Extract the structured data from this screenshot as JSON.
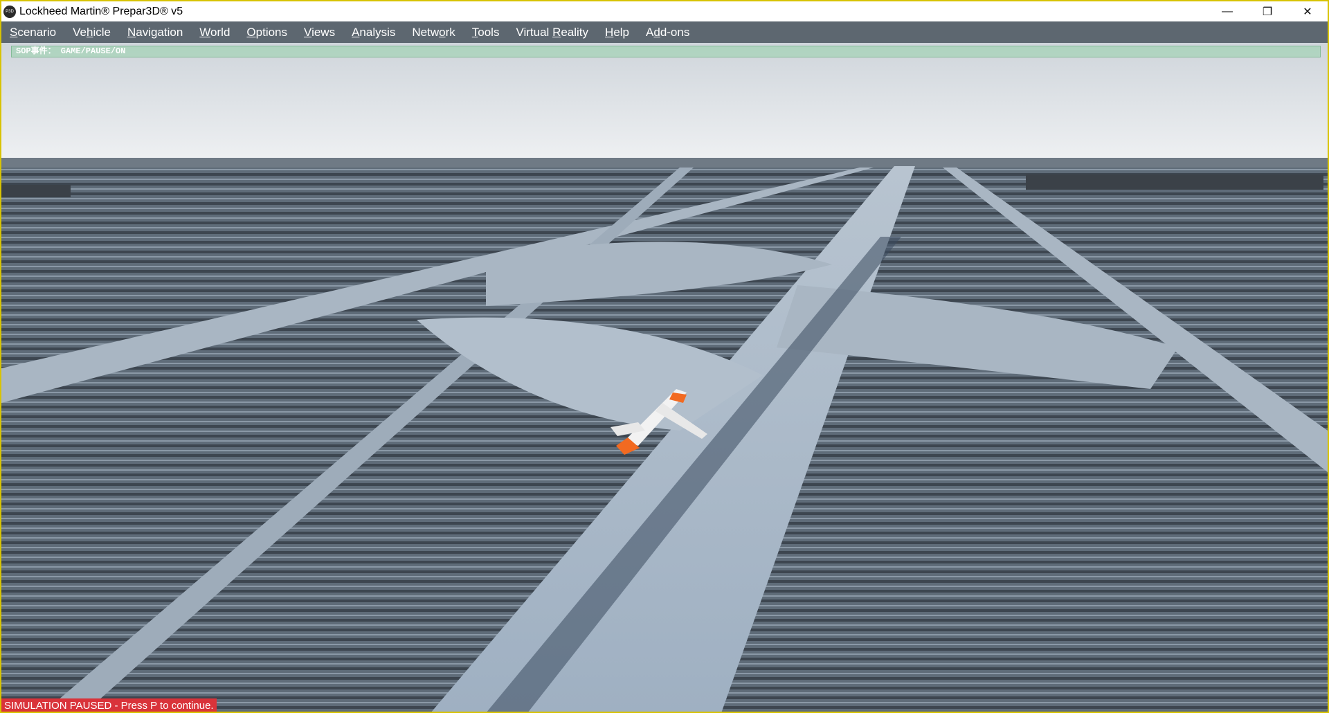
{
  "window": {
    "title": "Lockheed Martin® Prepar3D® v5",
    "app_icon_text": "P3D",
    "controls": {
      "minimize": "—",
      "restore": "❐",
      "close": "✕"
    }
  },
  "menu": [
    {
      "mnemonic": "S",
      "rest": "cenario"
    },
    {
      "pre": "Ve",
      "mnemonic": "h",
      "rest": "icle"
    },
    {
      "mnemonic": "N",
      "rest": "avigation"
    },
    {
      "mnemonic": "W",
      "rest": "orld"
    },
    {
      "mnemonic": "O",
      "rest": "ptions"
    },
    {
      "mnemonic": "V",
      "rest": "iews"
    },
    {
      "mnemonic": "A",
      "rest": "nalysis"
    },
    {
      "pre": "Netw",
      "mnemonic": "o",
      "rest": "rk"
    },
    {
      "mnemonic": "T",
      "rest": "ools"
    },
    {
      "pre": "Virtual ",
      "mnemonic": "R",
      "rest": "eality"
    },
    {
      "mnemonic": "H",
      "rest": "elp"
    },
    {
      "pre": "A",
      "mnemonic": "d",
      "rest": "d-ons"
    }
  ],
  "event_bar": {
    "text": "SOP事件： GAME/PAUSE/ON"
  },
  "status": {
    "paused_text": "SIMULATION PAUSED - Press P to continue."
  },
  "colors": {
    "border": "#d8c300",
    "menubar": "#5d6770",
    "paused_bg": "#d9333a"
  }
}
